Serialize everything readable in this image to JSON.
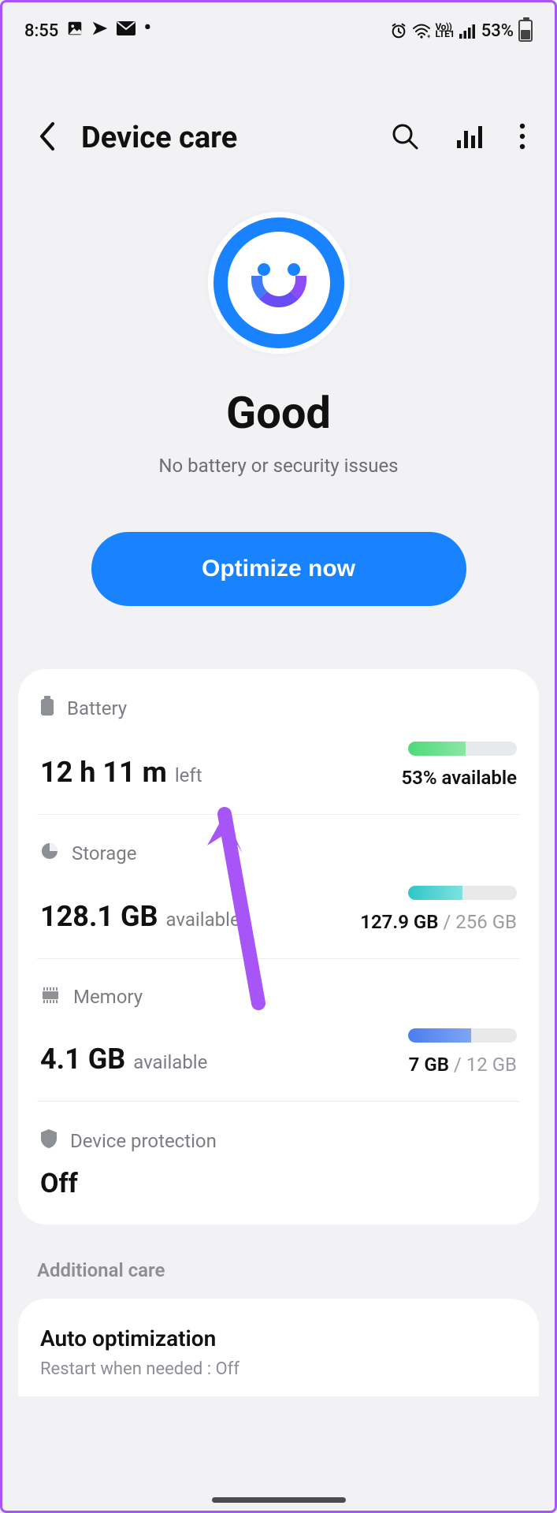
{
  "status_bar": {
    "time": "8:55",
    "battery_percent": "53%"
  },
  "header": {
    "title": "Device care"
  },
  "hero": {
    "status_title": "Good",
    "status_subtitle": "No battery or security issues",
    "optimize_button": "Optimize now"
  },
  "rows": {
    "battery": {
      "label": "Battery",
      "value": "12 h 11 m",
      "suffix": "left",
      "available_text": "53% available",
      "fill_percent": 53
    },
    "storage": {
      "label": "Storage",
      "value": "128.1 GB",
      "suffix": "available",
      "used": "127.9 GB",
      "total": "256 GB",
      "fill_percent": 50
    },
    "memory": {
      "label": "Memory",
      "value": "4.1 GB",
      "suffix": "available",
      "used": "7 GB",
      "total": "12 GB",
      "fill_percent": 58
    },
    "protection": {
      "label": "Device protection",
      "value": "Off"
    }
  },
  "additional": {
    "section_label": "Additional care",
    "auto_opt_title": "Auto optimization",
    "auto_opt_sub": "Restart when needed : Off"
  }
}
